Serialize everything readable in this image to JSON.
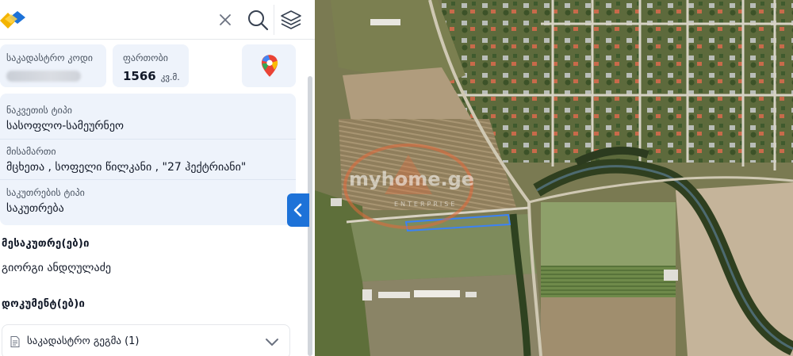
{
  "search": {
    "clear_icon": "close-icon",
    "search_icon": "search-icon",
    "layers_icon": "layers-icon",
    "logo_icon": "brand-logo-icon"
  },
  "parcel": {
    "cadastral_code_label": "საკადასტრო კოდი",
    "area_label": "ფართობი",
    "area_value": "1566",
    "area_unit": "კვ.მ.",
    "maps_icon": "google-maps-pin-icon",
    "land_type_label": "ნაკვეთის ტიპი",
    "land_type_value": "სასოფლო-სამეურნეო",
    "address_label": "მისამართი",
    "address_value": "მცხეთა , სოფელი წილკანი , \"27 ჰექტრიანი\"",
    "ownership_label": "საკუთრების ტიპი",
    "ownership_value": "საკუთრება"
  },
  "owners": {
    "title": "მესაკუთრე(ებ)ი",
    "names": [
      "გიორგი ანდღულაძე"
    ]
  },
  "documents": {
    "title": "დოკუმენტ(ებ)ი",
    "items": [
      {
        "label": "საკადასტრო გეგმა (1)",
        "icon": "document-icon",
        "chevron": "chevron-down-icon"
      }
    ]
  },
  "panel": {
    "collapse_icon": "chevron-left-icon"
  },
  "map": {
    "watermark_brand": "myhome.ge",
    "watermark_sub": "ENTERPRISE",
    "parcel_outline_color": "#3b82f6",
    "accent_color": "#1d72d8"
  }
}
